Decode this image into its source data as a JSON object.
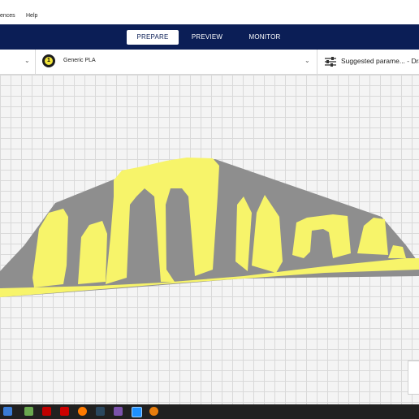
{
  "menubar": {
    "items": [
      "ences",
      "Help"
    ]
  },
  "header": {
    "tabs": [
      {
        "label": "PREPARE",
        "active": true
      },
      {
        "label": "PREVIEW",
        "active": false
      },
      {
        "label": "MONITOR",
        "active": false
      }
    ]
  },
  "settings": {
    "extruder_number": "1",
    "material": "Generic PLA",
    "params_label": "Suggested parame... - Dra"
  },
  "colors": {
    "header": "#0b1e56",
    "model_yellow": "#f7f46a",
    "model_gray": "#8e8e8e"
  },
  "taskbar": {
    "icons": [
      "windows-icon",
      "search-icon",
      "task-view-icon",
      "xbox-icon",
      "file-manager-icon",
      "netflix-icon",
      "app-icon",
      "firefox-icon",
      "steam-icon",
      "game-icon",
      "cura-icon",
      "blender-icon"
    ]
  }
}
